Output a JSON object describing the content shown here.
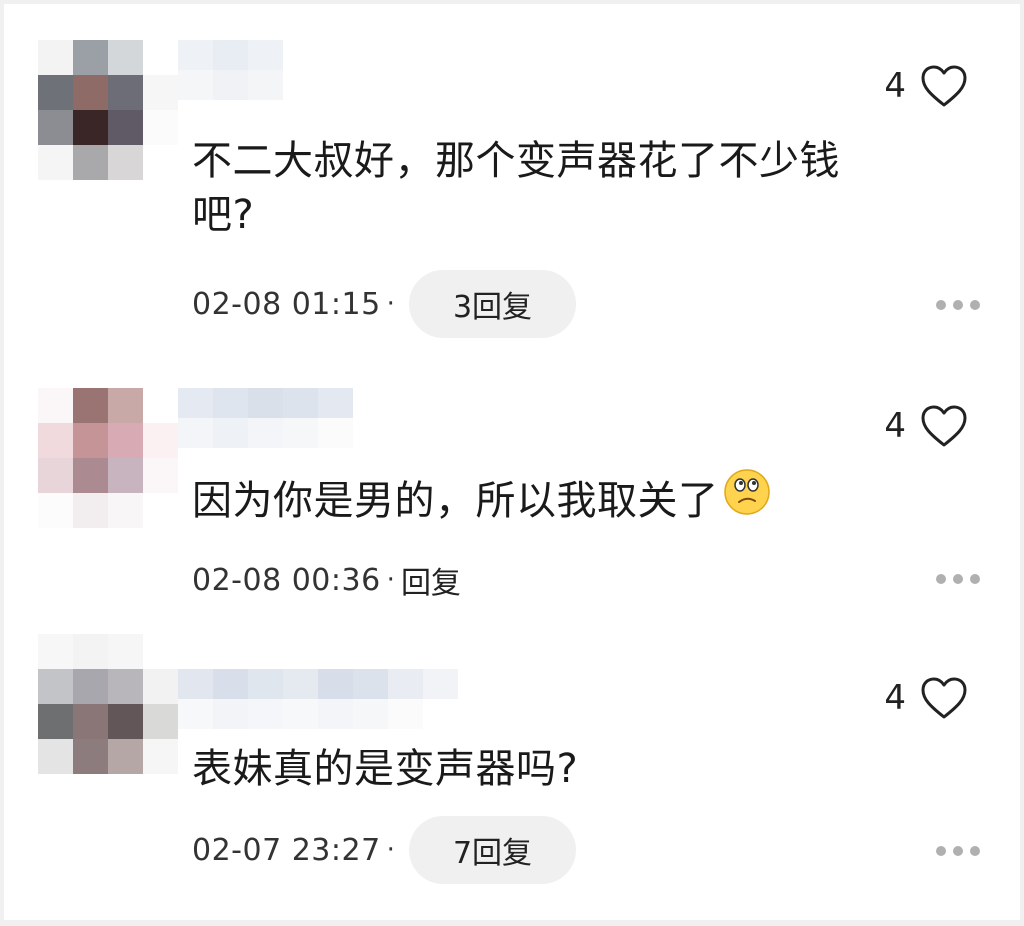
{
  "comments": [
    {
      "likes": "4",
      "text": "不二大叔好，那个变声器花了不少钱吧?",
      "line1": "不二大叔好，那个变声器花了不少钱",
      "line2": "吧?",
      "timestamp": "02-08 01:15",
      "separator": "·",
      "reply_label": "3回复"
    },
    {
      "likes": "4",
      "text": "因为你是男的，所以我取关了",
      "emoji": "smiley-frown-emoji",
      "timestamp": "02-08 00:36",
      "separator": "·",
      "reply_label": "回复"
    },
    {
      "likes": "4",
      "text": "表妹真的是变声器吗?",
      "timestamp": "02-07 23:27",
      "separator": "·",
      "reply_label": "7回复"
    }
  ],
  "icons": {
    "like": "heart-outline-icon",
    "more": "more-dots-icon"
  },
  "colors": {
    "background": "#ffffff",
    "text": "#1a1a1a",
    "pill": "#f0f0f0",
    "dots": "#b0b0b0"
  }
}
